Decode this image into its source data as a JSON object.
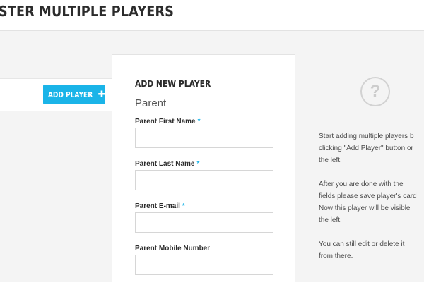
{
  "header": {
    "title": "STER MULTIPLE PLAYERS"
  },
  "toolbar": {
    "add_label": "ADD PLAYER",
    "add_icon": "plus-icon"
  },
  "form": {
    "title": "ADD NEW PLAYER",
    "section": "Parent",
    "fields": [
      {
        "label": "Parent First Name",
        "required": "*",
        "value": ""
      },
      {
        "label": "Parent Last Name",
        "required": "*",
        "value": ""
      },
      {
        "label": "Parent E-mail",
        "required": "*",
        "value": ""
      },
      {
        "label": "Parent Mobile Number",
        "required": "",
        "value": ""
      }
    ]
  },
  "help": {
    "icon": "question-icon",
    "paragraphs": [
      "Start adding multiple players b\nclicking \"Add Player\" button or\nthe left.",
      "After you are done with the\nfields please save player's card\nNow this player will be visible \nthe left.",
      "You can still edit or delete it\nfrom there."
    ]
  },
  "colors": {
    "accent": "#1ab4e8",
    "background": "#f4f4f4"
  }
}
